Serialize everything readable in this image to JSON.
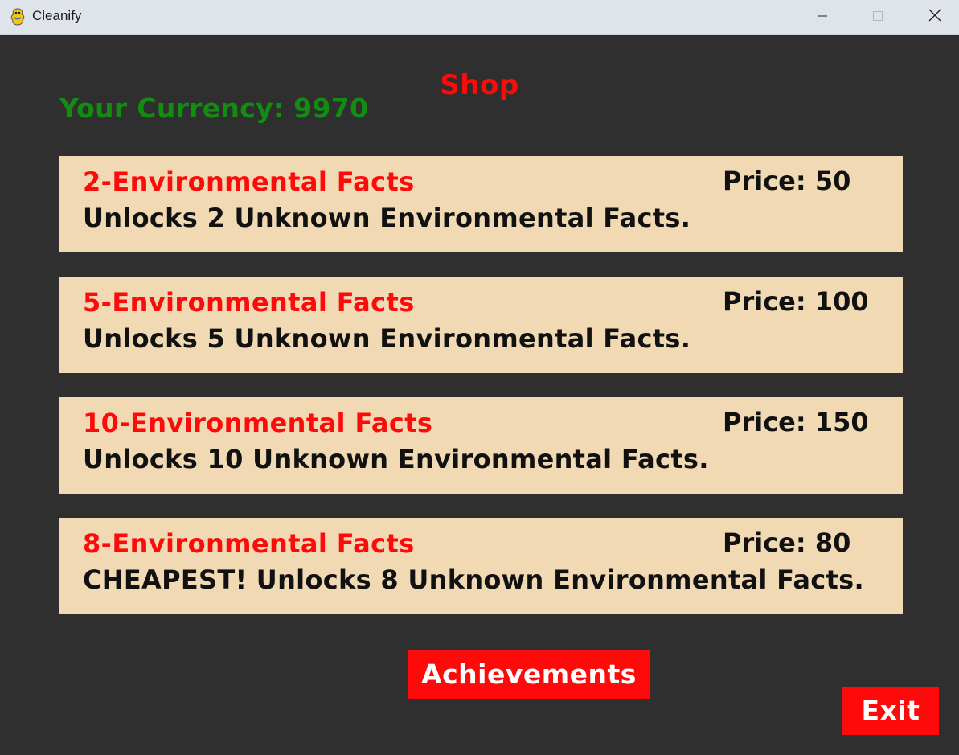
{
  "window": {
    "title": "Cleanify",
    "icon": "pygame-snake-icon",
    "controls": [
      "minimize-icon",
      "maximize-icon",
      "close-icon"
    ]
  },
  "shop": {
    "title": "Shop",
    "currency_text": "Your Currency: 9970",
    "items": [
      {
        "name": "2-Environmental Facts",
        "price": "Price: 50",
        "description": "Unlocks 2 Unknown Environmental Facts."
      },
      {
        "name": "5-Environmental Facts",
        "price": "Price: 100",
        "description": "Unlocks 5 Unknown Environmental Facts."
      },
      {
        "name": "10-Environmental Facts",
        "price": "Price: 150",
        "description": "Unlocks 10 Unknown Environmental Facts."
      },
      {
        "name": "8-Environmental Facts",
        "price": "Price: 80",
        "description": "CHEAPEST! Unlocks 8 Unknown Environmental Facts."
      }
    ]
  },
  "buttons": {
    "achievements_label": "Achievements",
    "exit_label": "Exit"
  },
  "colors": {
    "background": "#2f2f2f",
    "accent_red": "#ff0a0a",
    "currency_green": "#128d12",
    "item_background": "#f1dab3",
    "titlebar": "#dfe3ea"
  }
}
